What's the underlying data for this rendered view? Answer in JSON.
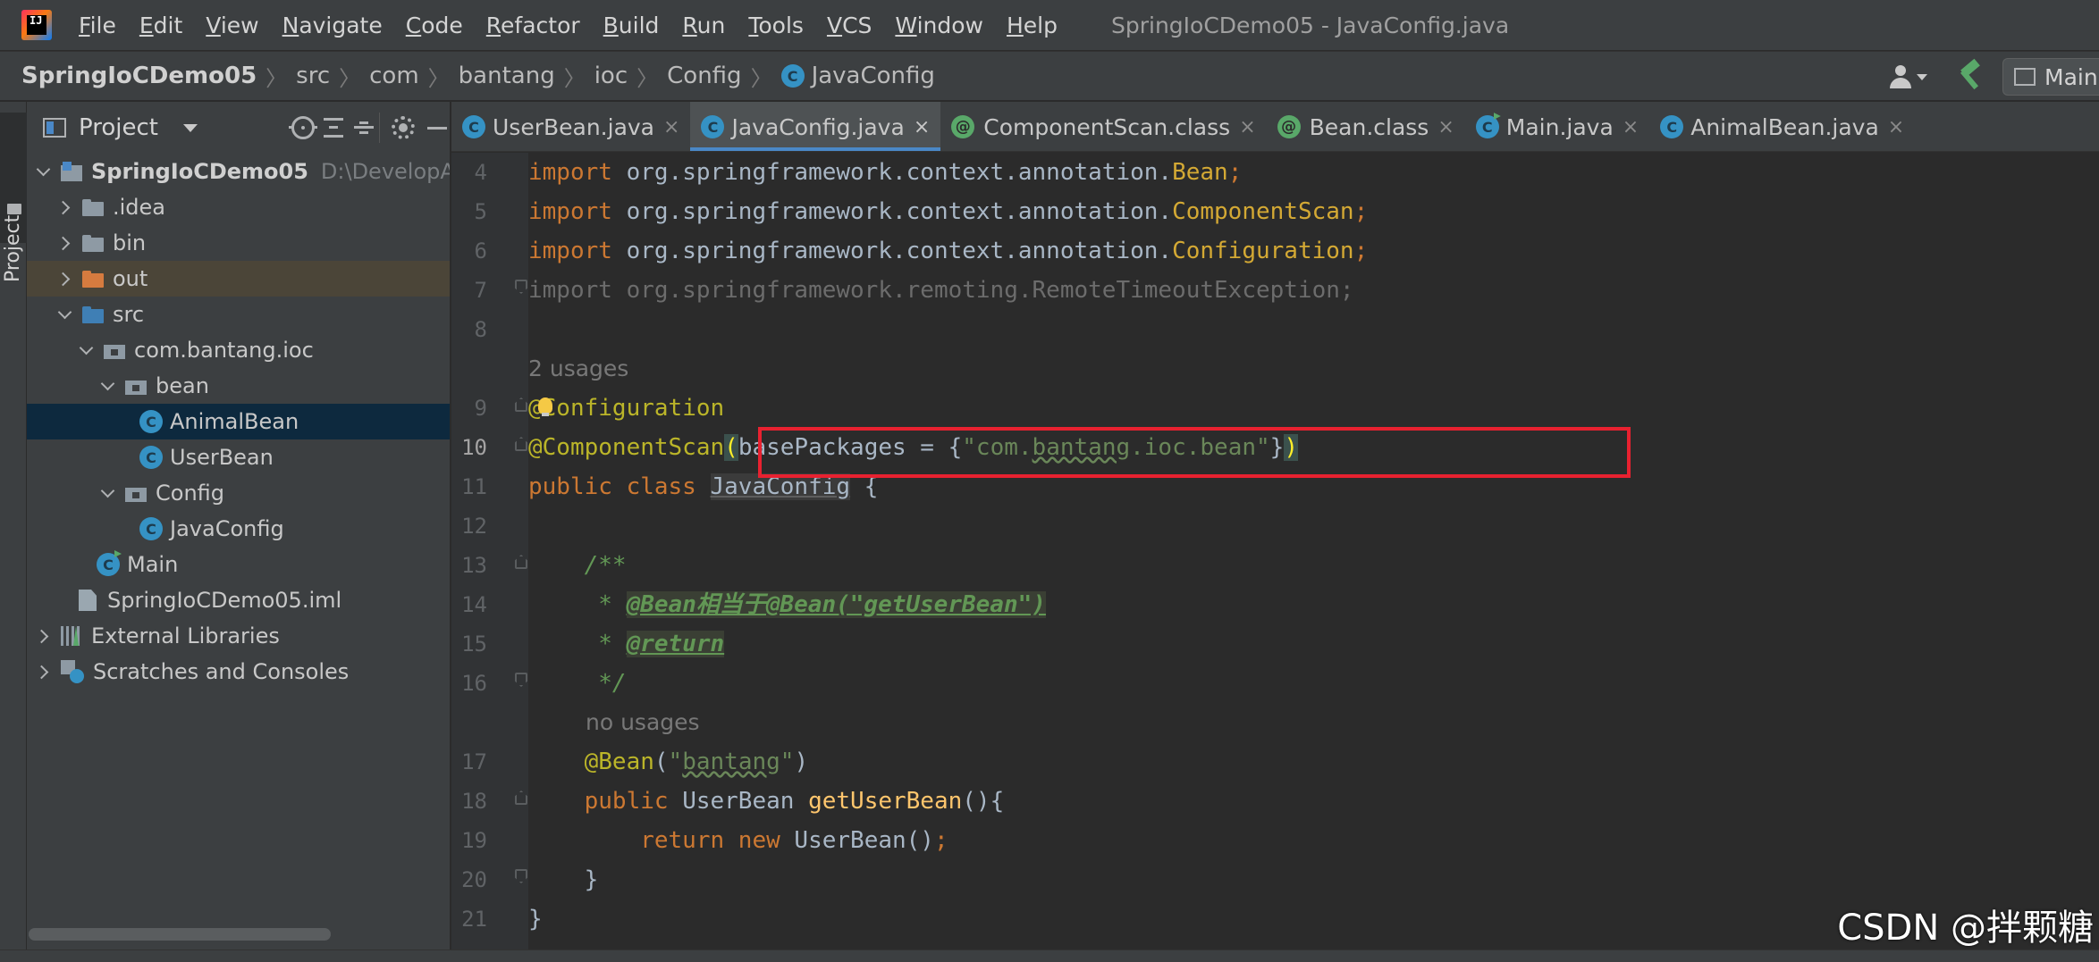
{
  "menubar": {
    "logo_text": "IJ",
    "items": [
      {
        "mnemonic": "F",
        "rest": "ile"
      },
      {
        "mnemonic": "E",
        "rest": "dit"
      },
      {
        "mnemonic": "V",
        "rest": "iew"
      },
      {
        "mnemonic": "N",
        "rest": "avigate"
      },
      {
        "mnemonic": "C",
        "rest": "ode"
      },
      {
        "mnemonic": "R",
        "rest": "efactor"
      },
      {
        "mnemonic": "B",
        "rest": "uild"
      },
      {
        "mnemonic": "R",
        "rest": "un",
        "pre": ""
      },
      {
        "mnemonic": "T",
        "rest": "ools"
      },
      {
        "mnemonic": "V",
        "rest": "CS"
      },
      {
        "mnemonic": "W",
        "rest": "indow"
      },
      {
        "mnemonic": "H",
        "rest": "elp"
      }
    ],
    "window_title": "SpringIoCDemo05 - JavaConfig.java"
  },
  "breadcrumb": {
    "items": [
      "SpringIoCDemo05",
      "src",
      "com",
      "bantang",
      "ioc",
      "Config",
      "JavaConfig"
    ],
    "run_config_label": "Main"
  },
  "tool_strip": {
    "project_label": "Project"
  },
  "project_panel": {
    "title": "Project",
    "tree": [
      {
        "label": "SpringIoCDemo05",
        "path": "D:\\DevelopApplication\\JavaWorkS",
        "bold": true
      },
      {
        "label": ".idea"
      },
      {
        "label": "bin"
      },
      {
        "label": "out"
      },
      {
        "label": "src"
      },
      {
        "label": "com.bantang.ioc"
      },
      {
        "label": "bean"
      },
      {
        "label": "AnimalBean"
      },
      {
        "label": "UserBean"
      },
      {
        "label": "Config"
      },
      {
        "label": "JavaConfig"
      },
      {
        "label": "Main"
      },
      {
        "label": "SpringIoCDemo05.iml"
      },
      {
        "label": "External Libraries"
      },
      {
        "label": "Scratches and Consoles"
      }
    ],
    "class_icon_letter": "C"
  },
  "tabs": [
    {
      "label": "UserBean.java",
      "icon": "class-icon",
      "active": false
    },
    {
      "label": "JavaConfig.java",
      "icon": "class-icon",
      "active": true
    },
    {
      "label": "ComponentScan.class",
      "icon": "annotation-icon",
      "active": false
    },
    {
      "label": "Bean.class",
      "icon": "annotation-icon",
      "active": false
    },
    {
      "label": "Main.java",
      "icon": "main-class-icon",
      "active": false
    },
    {
      "label": "AnimalBean.java",
      "icon": "class-icon",
      "active": false
    }
  ],
  "tab_close": "×",
  "annotation_icon_letter": "@",
  "editor": {
    "line_numbers": [
      "4",
      "5",
      "6",
      "7",
      "8",
      "9",
      "10",
      "11",
      "12",
      "13",
      "14",
      "15",
      "16",
      "17",
      "18",
      "19",
      "20",
      "21"
    ],
    "hints": {
      "two_usages": "2 usages",
      "no_usages": "no usages"
    },
    "code": {
      "l4_kw": "import",
      "l4_pkg": " org.springframework.context.annotation.",
      "l4_cls": "Bean",
      "l4_semi": ";",
      "l5_kw": "import",
      "l5_pkg": " org.springframework.context.annotation.",
      "l5_cls": "ComponentScan",
      "l5_semi": ";",
      "l6_kw": "import",
      "l6_pkg": " org.springframework.context.annotation.",
      "l6_cls": "Configuration",
      "l6_semi": ";",
      "l7_text": "import org.springframework.remoting.RemoteTimeoutException;",
      "l9_at": "@",
      "l9_rest": "Configuration",
      "l10_ann": "@ComponentScan",
      "l10_paren": "(",
      "l10_attr": "basePackages = {",
      "l10_q1": "\"com.",
      "l10_sq": "bantang",
      "l10_q2": ".ioc.bean\"",
      "l10_close": "}",
      "l10_paren2": ")",
      "l11_kw": "public class ",
      "l11_cls": "JavaConfig",
      "l11_brace": " {",
      "l13_cm": "    /**",
      "l14_star": "     * ",
      "l14_tag": "@Bean相当于@Bean(\"getUserBean\")",
      "l15_star": "     * ",
      "l15_tag": "@return",
      "l16_cm": "     */",
      "l17_ann": "    @Bean",
      "l17_p1": "(",
      "l17_q1": "\"",
      "l17_sq": "bantang",
      "l17_q2": "\"",
      "l17_p2": ")",
      "l18_kw": "    public ",
      "l18_type": "UserBean ",
      "l18_fn": "getUserBean",
      "l18_rest": "(){",
      "l19_kw": "        return new ",
      "l19_rest": "UserBean()",
      "l19_semi": ";",
      "l20_text": "    }",
      "l21_text": "}"
    }
  },
  "watermark": "CSDN @拌颗糖"
}
